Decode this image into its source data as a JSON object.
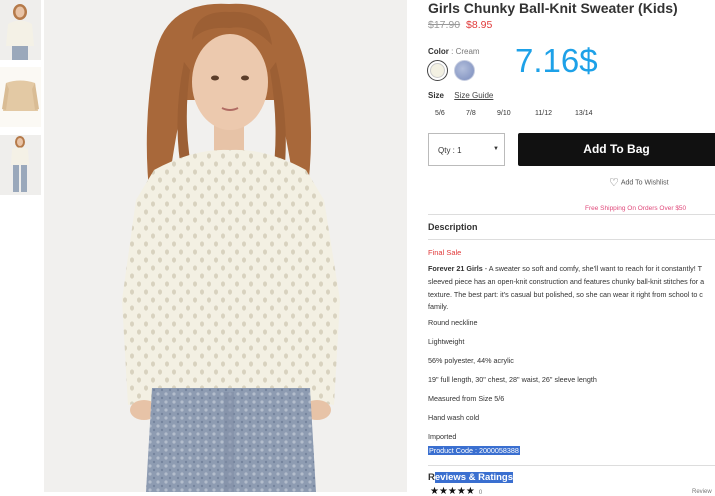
{
  "product": {
    "title": "Girls Chunky Ball-Knit Sweater (Kids)",
    "price_old": "$17.90",
    "price_new": "$8.95"
  },
  "annotation": "7.16$",
  "color": {
    "label": "Color",
    "separator": " : ",
    "value": "Cream",
    "swatches": [
      "cream",
      "blue"
    ],
    "swatch_colors": {
      "cream": "#f3f1e3",
      "blue": "#8b9bc6"
    }
  },
  "size": {
    "label": "Size",
    "guide": "Size Guide",
    "options": [
      "5/6",
      "7/8",
      "9/10",
      "11/12",
      "13/14"
    ]
  },
  "qty": {
    "value": "Qty : 1"
  },
  "add_to_bag": "Add To Bag",
  "wishlist": "Add To Wishlist",
  "free_shipping": "Free Shipping On Orders Over $50",
  "description": {
    "heading": "Description",
    "final_sale": "Final Sale",
    "brand": "Forever 21 Girls",
    "lines": [
      " - A sweater so soft and comfy, she'll want to reach for it constantly! T",
      "sleeved piece has an open-knit construction and features chunky ball-knit stitches for a",
      "texture. The best part: it's casual but polished, so she can wear it right from school to c",
      "family."
    ],
    "features": [
      "Round neckline",
      "Lightweight",
      "56% polyester, 44% acrylic",
      "19\" full length, 30\" chest, 28\" waist, 26\" sleeve length",
      "Measured from Size 5/6",
      "Hand wash cold",
      "Imported"
    ],
    "product_code": "Product Code : 2000058388"
  },
  "reviews": {
    "heading_first": "R",
    "heading_rest": "eviews & Ratings",
    "stars": "★★★★★",
    "count": "0",
    "right_text": "Review"
  },
  "colors": {
    "price_sale": "#e03a3a",
    "annotation": "#1da1e8",
    "button": "#111111",
    "free_shipping": "#e0487a",
    "selection": "#3a6fd0"
  },
  "icons": [
    "heart-icon",
    "chevron-down-icon",
    "star-icon"
  ]
}
